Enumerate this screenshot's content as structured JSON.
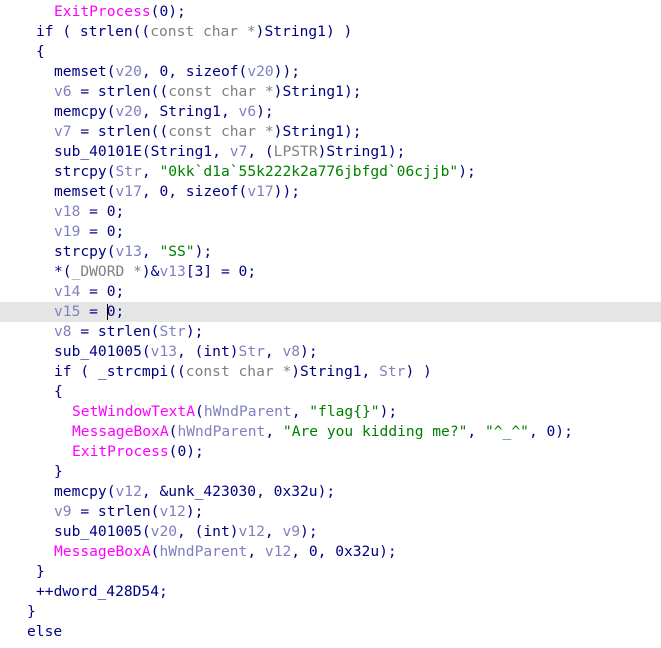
{
  "editor": {
    "caret_line": 15,
    "lines": [
      {
        "indent": 4,
        "tokens": [
          [
            "ExitProcess",
            "func"
          ],
          [
            "(0);",
            "plain"
          ]
        ]
      },
      {
        "indent": 2,
        "tokens": [
          [
            "if ( strlen((",
            "plain"
          ],
          [
            "const char *",
            "cast"
          ],
          [
            ")String1) )",
            "plain"
          ]
        ]
      },
      {
        "indent": 2,
        "tokens": [
          [
            "{",
            "plain"
          ]
        ]
      },
      {
        "indent": 4,
        "tokens": [
          [
            "memset(",
            "plain"
          ],
          [
            "v20",
            "var"
          ],
          [
            ", 0, sizeof(",
            "plain"
          ],
          [
            "v20",
            "var"
          ],
          [
            "));",
            "plain"
          ]
        ]
      },
      {
        "indent": 4,
        "tokens": [
          [
            "v6",
            "var"
          ],
          [
            " = strlen((",
            "plain"
          ],
          [
            "const char *",
            "cast"
          ],
          [
            ")String1);",
            "plain"
          ]
        ]
      },
      {
        "indent": 4,
        "tokens": [
          [
            "memcpy(",
            "plain"
          ],
          [
            "v20",
            "var"
          ],
          [
            ", String1, ",
            "plain"
          ],
          [
            "v6",
            "var"
          ],
          [
            ");",
            "plain"
          ]
        ]
      },
      {
        "indent": 4,
        "tokens": [
          [
            "v7",
            "var"
          ],
          [
            " = strlen((",
            "plain"
          ],
          [
            "const char *",
            "cast"
          ],
          [
            ")String1);",
            "plain"
          ]
        ]
      },
      {
        "indent": 4,
        "tokens": [
          [
            "sub_40101E(String1, ",
            "plain"
          ],
          [
            "v7",
            "var"
          ],
          [
            ", (",
            "plain"
          ],
          [
            "LPSTR",
            "cast"
          ],
          [
            ")String1);",
            "plain"
          ]
        ]
      },
      {
        "indent": 4,
        "tokens": [
          [
            "strcpy(",
            "plain"
          ],
          [
            "Str",
            "var"
          ],
          [
            ", ",
            "plain"
          ],
          [
            "\"0kk`d1a`55k222k2a776jbfgd`06cjjb\"",
            "str"
          ],
          [
            ");",
            "plain"
          ]
        ]
      },
      {
        "indent": 4,
        "tokens": [
          [
            "memset(",
            "plain"
          ],
          [
            "v17",
            "var"
          ],
          [
            ", 0, sizeof(",
            "plain"
          ],
          [
            "v17",
            "var"
          ],
          [
            "));",
            "plain"
          ]
        ]
      },
      {
        "indent": 4,
        "tokens": [
          [
            "v18",
            "var"
          ],
          [
            " = 0;",
            "plain"
          ]
        ]
      },
      {
        "indent": 4,
        "tokens": [
          [
            "v19",
            "var"
          ],
          [
            " = 0;",
            "plain"
          ]
        ]
      },
      {
        "indent": 4,
        "tokens": [
          [
            "strcpy(",
            "plain"
          ],
          [
            "v13",
            "var"
          ],
          [
            ", ",
            "plain"
          ],
          [
            "\"SS\"",
            "str"
          ],
          [
            ");",
            "plain"
          ]
        ]
      },
      {
        "indent": 4,
        "tokens": [
          [
            "*(",
            "plain"
          ],
          [
            "_DWORD *",
            "cast"
          ],
          [
            ")&",
            "plain"
          ],
          [
            "v13",
            "var"
          ],
          [
            "[3] = 0;",
            "plain"
          ]
        ]
      },
      {
        "indent": 4,
        "tokens": [
          [
            "v14",
            "var"
          ],
          [
            " = 0;",
            "plain"
          ]
        ]
      },
      {
        "indent": 4,
        "tokens": [
          [
            "v15",
            "var"
          ],
          [
            " = 0;",
            "plain"
          ]
        ]
      },
      {
        "indent": 4,
        "tokens": [
          [
            "v8",
            "var"
          ],
          [
            " = strlen(",
            "plain"
          ],
          [
            "Str",
            "var"
          ],
          [
            ");",
            "plain"
          ]
        ]
      },
      {
        "indent": 4,
        "tokens": [
          [
            "sub_401005(",
            "plain"
          ],
          [
            "v13",
            "var"
          ],
          [
            ", (int)",
            "plain"
          ],
          [
            "Str",
            "var"
          ],
          [
            ", ",
            "plain"
          ],
          [
            "v8",
            "var"
          ],
          [
            ");",
            "plain"
          ]
        ]
      },
      {
        "indent": 4,
        "tokens": [
          [
            "if ( _strcmpi((",
            "plain"
          ],
          [
            "const char *",
            "cast"
          ],
          [
            ")String1, ",
            "plain"
          ],
          [
            "Str",
            "var"
          ],
          [
            ") )",
            "plain"
          ]
        ]
      },
      {
        "indent": 4,
        "tokens": [
          [
            "{",
            "plain"
          ]
        ]
      },
      {
        "indent": 6,
        "tokens": [
          [
            "SetWindowTextA",
            "func"
          ],
          [
            "(",
            "plain"
          ],
          [
            "hWndParent",
            "var"
          ],
          [
            ", ",
            "plain"
          ],
          [
            "\"flag{}\"",
            "str"
          ],
          [
            ");",
            "plain"
          ]
        ]
      },
      {
        "indent": 6,
        "tokens": [
          [
            "MessageBoxA",
            "func"
          ],
          [
            "(",
            "plain"
          ],
          [
            "hWndParent",
            "var"
          ],
          [
            ", ",
            "plain"
          ],
          [
            "\"Are you kidding me?\"",
            "str"
          ],
          [
            ", ",
            "plain"
          ],
          [
            "\"^_^\"",
            "str"
          ],
          [
            ", 0);",
            "plain"
          ]
        ]
      },
      {
        "indent": 6,
        "tokens": [
          [
            "ExitProcess",
            "func"
          ],
          [
            "(0);",
            "plain"
          ]
        ]
      },
      {
        "indent": 4,
        "tokens": [
          [
            "}",
            "plain"
          ]
        ]
      },
      {
        "indent": 4,
        "tokens": [
          [
            "memcpy(",
            "plain"
          ],
          [
            "v12",
            "var"
          ],
          [
            ", &unk_423030, 0x32u);",
            "plain"
          ]
        ]
      },
      {
        "indent": 4,
        "tokens": [
          [
            "v9",
            "var"
          ],
          [
            " = strlen(",
            "plain"
          ],
          [
            "v12",
            "var"
          ],
          [
            ");",
            "plain"
          ]
        ]
      },
      {
        "indent": 4,
        "tokens": [
          [
            "sub_401005(",
            "plain"
          ],
          [
            "v20",
            "var"
          ],
          [
            ", (int)",
            "plain"
          ],
          [
            "v12",
            "var"
          ],
          [
            ", ",
            "plain"
          ],
          [
            "v9",
            "var"
          ],
          [
            ");",
            "plain"
          ]
        ]
      },
      {
        "indent": 4,
        "tokens": [
          [
            "MessageBoxA",
            "func"
          ],
          [
            "(",
            "plain"
          ],
          [
            "hWndParent",
            "var"
          ],
          [
            ", ",
            "plain"
          ],
          [
            "v12",
            "var"
          ],
          [
            ", 0, 0x32u);",
            "plain"
          ]
        ]
      },
      {
        "indent": 2,
        "tokens": [
          [
            "}",
            "plain"
          ]
        ]
      },
      {
        "indent": 2,
        "tokens": [
          [
            "++dword_428D54;",
            "plain"
          ]
        ]
      },
      {
        "indent": 1,
        "tokens": [
          [
            "}",
            "plain"
          ]
        ]
      },
      {
        "indent": 1,
        "tokens": [
          [
            "else",
            "plain"
          ]
        ]
      }
    ]
  }
}
